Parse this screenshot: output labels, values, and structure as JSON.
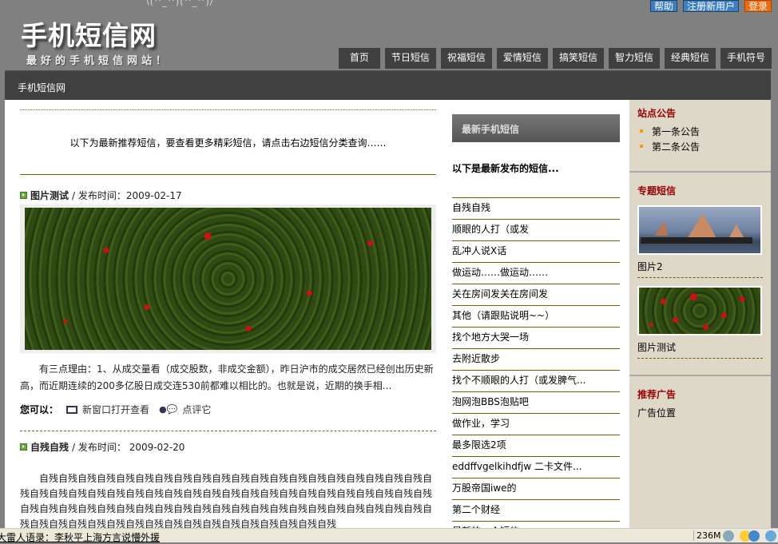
{
  "header": {
    "emote": "\\(^_^)(^_^)/",
    "logo": "手机短信网",
    "slogan": "最好的手机短信网站！",
    "top_buttons": [
      "帮助",
      "注册新用户",
      "登录"
    ],
    "nav": [
      "首页",
      "节日短信",
      "祝福短信",
      "爱情短信",
      "搞笑短信",
      "智力短信",
      "经典短信",
      "手机符号"
    ]
  },
  "breadcrumb": "手机短信网",
  "main": {
    "intro": "以下为最新推荐短信，要查看更多精彩短信，请点击右边短信分类查询……",
    "posts": [
      {
        "title": "图片测试",
        "meta": "/ 发布时间：2009-02-17",
        "text": "有三点理由：1、从成交量看（成交股数，非成交金额），昨日沪市的成交居然已经创出历史新高，而近期连续的200多亿股日成交连530前都难以相比的。也就是说，近期的换手相...",
        "actions_label": "您可以：",
        "open_new": "新窗口打开查看",
        "comment": "点评它"
      },
      {
        "title": "自残自残",
        "meta": "/ 发布时间： 2009-02-20",
        "text": "自残自残自残自残自残自残自残自残自残自残自残自残自残自残自残自残自残自残自残自残自残自残自残自残自残自残自残自残自残自残自残自残自残自残自残自残自残自残自残自残自残自残自残自残自残自残自残自残自残自残自残自残自残自残自残自残自残自残自残自残自残自残自残自残自残自残自残自残自残自残自残自残自残自残自残自残自残自残自残自残"
      }
    ]
  },
  "middle": {
    "title": "最新手机短信",
    "subtitle": "以下是最新发布的短信...",
    "items": [
      "自残自残",
      "顺眼的人打（或发",
      "乱冲人说X话",
      "做运动……做运动……",
      "关在房间发关在房间发",
      "其他（请跟贴说明~~）",
      "找个地方大哭一场",
      "去附近散步",
      "找个不顺眼的人打（或发脾气...",
      "泡网泡BBS泡贴吧",
      "做作业，学习",
      "最多限选2项",
      "eddffvgelkihdfjw 二卡文件...",
      "万股帝国iwe的",
      "第二个财经",
      "最新的一个短信"
    ]
  },
  "right": {
    "notice_title": "站点公告",
    "notices": [
      "第一条公告",
      "第二条公告"
    ],
    "topic_title": "专题短信",
    "topics": [
      "图片2",
      "图片测试"
    ],
    "ad_title": "推荐广告",
    "ad_text": "广告位置"
  },
  "status": {
    "link": "大雷人语录：李秋平上海方言说懵外援",
    "memory": "236M"
  }
}
